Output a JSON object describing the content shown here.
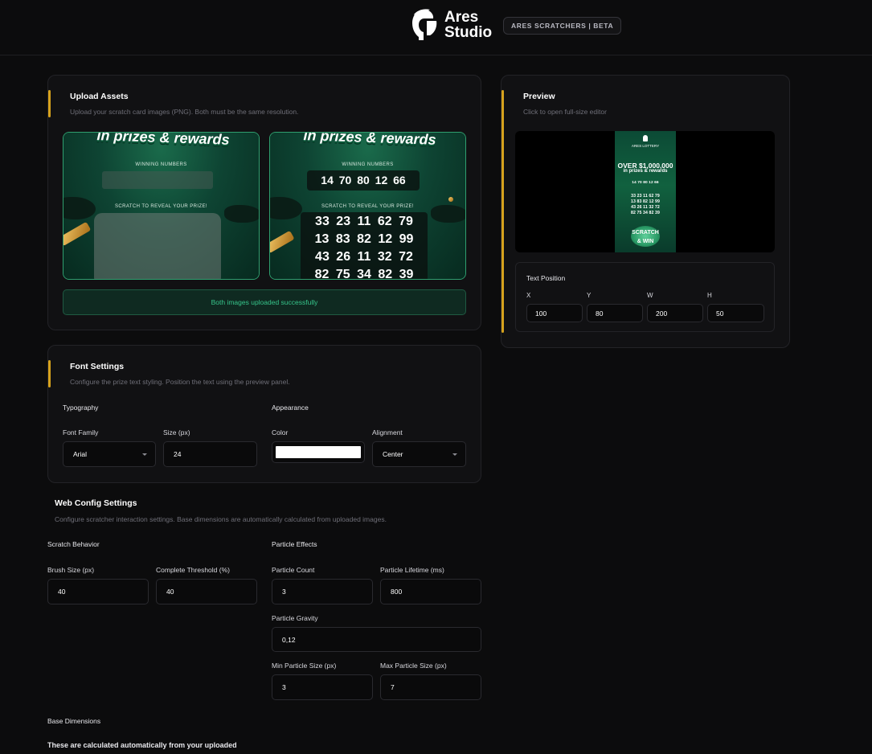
{
  "header": {
    "brand_line1": "Ares",
    "brand_line2": "Studio",
    "badge": "ARES SCRATCHERS | BETA"
  },
  "upload": {
    "title": "Upload Assets",
    "subtitle": "Upload your scratch card images (PNG). Both must be the same resolution.",
    "banner_text": "in prizes & rewards",
    "winning_label": "WINNING NUMBERS",
    "scratch_label": "SCRATCH TO REVEAL YOUR PRIZE!",
    "winning_numbers": "14 70 80 12 66",
    "prize_rows": [
      "33 23 11 62 79",
      "13 83 82 12 99",
      "43 26 11 32 72",
      "82 75 34 82 39"
    ],
    "status": "Both images uploaded successfully"
  },
  "preview": {
    "title": "Preview",
    "subtitle": "Click to open full-size editor",
    "mini": {
      "brand": "ARES LOTTERY",
      "headline": "OVER $1,000,000",
      "subheadline": "in prizes & rewards",
      "winning": "14 70 80 12 66",
      "rows": [
        "33 23 11 62 79",
        "13 83 82 12 99",
        "43 26 11 32 72",
        "82 75 34 82 39"
      ],
      "cta": "SCRATCH & WIN"
    },
    "text_position": {
      "title": "Text Position",
      "x_label": "X",
      "x_value": "100",
      "y_label": "Y",
      "y_value": "80",
      "w_label": "W",
      "w_value": "200",
      "h_label": "H",
      "h_value": "50"
    }
  },
  "font": {
    "title": "Font Settings",
    "subtitle": "Configure the prize text styling. Position the text using the preview panel.",
    "typography_label": "Typography",
    "appearance_label": "Appearance",
    "family_label": "Font Family",
    "family_value": "Arial",
    "size_label": "Size (px)",
    "size_value": "24",
    "color_label": "Color",
    "color_value": "#ffffff",
    "alignment_label": "Alignment",
    "alignment_value": "Center"
  },
  "web_config": {
    "title": "Web Config Settings",
    "subtitle": "Configure scratcher interaction settings. Base dimensions are automatically calculated from uploaded images.",
    "scratch_behavior_label": "Scratch Behavior",
    "particle_effects_label": "Particle Effects",
    "brush_size_label": "Brush Size (px)",
    "brush_size_value": "40",
    "threshold_label": "Complete Threshold (%)",
    "threshold_value": "40",
    "particle_count_label": "Particle Count",
    "particle_count_value": "3",
    "particle_lifetime_label": "Particle Lifetime (ms)",
    "particle_lifetime_value": "800",
    "particle_gravity_label": "Particle Gravity",
    "particle_gravity_value": "0,12",
    "min_particle_label": "Min Particle Size (px)",
    "min_particle_value": "3",
    "max_particle_label": "Max Particle Size (px)",
    "max_particle_value": "7",
    "base_dimensions_label": "Base Dimensions",
    "base_dimensions_note": "These are calculated automatically from your uploaded"
  },
  "colors": {
    "accent": "#d6a21d",
    "success": "#36c48a",
    "background": "#0c0c0d"
  }
}
